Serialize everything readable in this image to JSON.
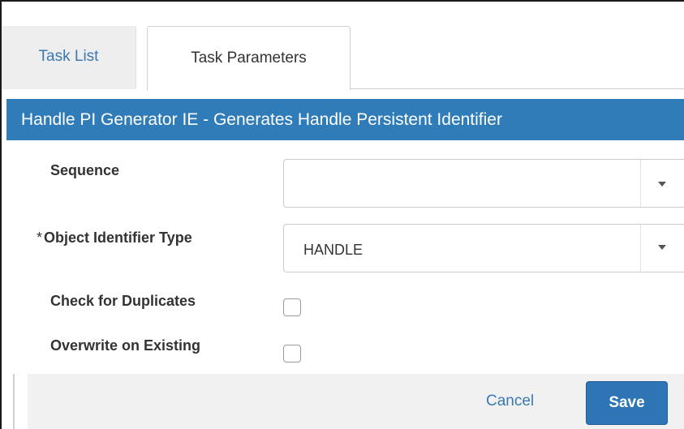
{
  "tabs": [
    {
      "label": "Task List",
      "active": false
    },
    {
      "label": "Task Parameters",
      "active": true
    }
  ],
  "header": {
    "title": "Handle PI Generator IE - Generates Handle Persistent Identifier"
  },
  "form": {
    "sequence": {
      "label": "Sequence",
      "value": "",
      "required": false
    },
    "object_identifier_type": {
      "label": "Object Identifier Type",
      "value": "HANDLE",
      "required": true,
      "required_marker": "*"
    },
    "check_for_duplicates": {
      "label": "Check for Duplicates",
      "checked": false
    },
    "overwrite_on_existing": {
      "label": "Overwrite on Existing",
      "checked": false
    }
  },
  "footer": {
    "cancel_label": "Cancel",
    "save_label": "Save"
  },
  "colors": {
    "header_bg": "#2f7cb8",
    "link": "#3b79b3",
    "save_button": "#2e75b6",
    "footer_bg": "#f1f1f1"
  },
  "icons": [
    "chevron-down-icon"
  ]
}
